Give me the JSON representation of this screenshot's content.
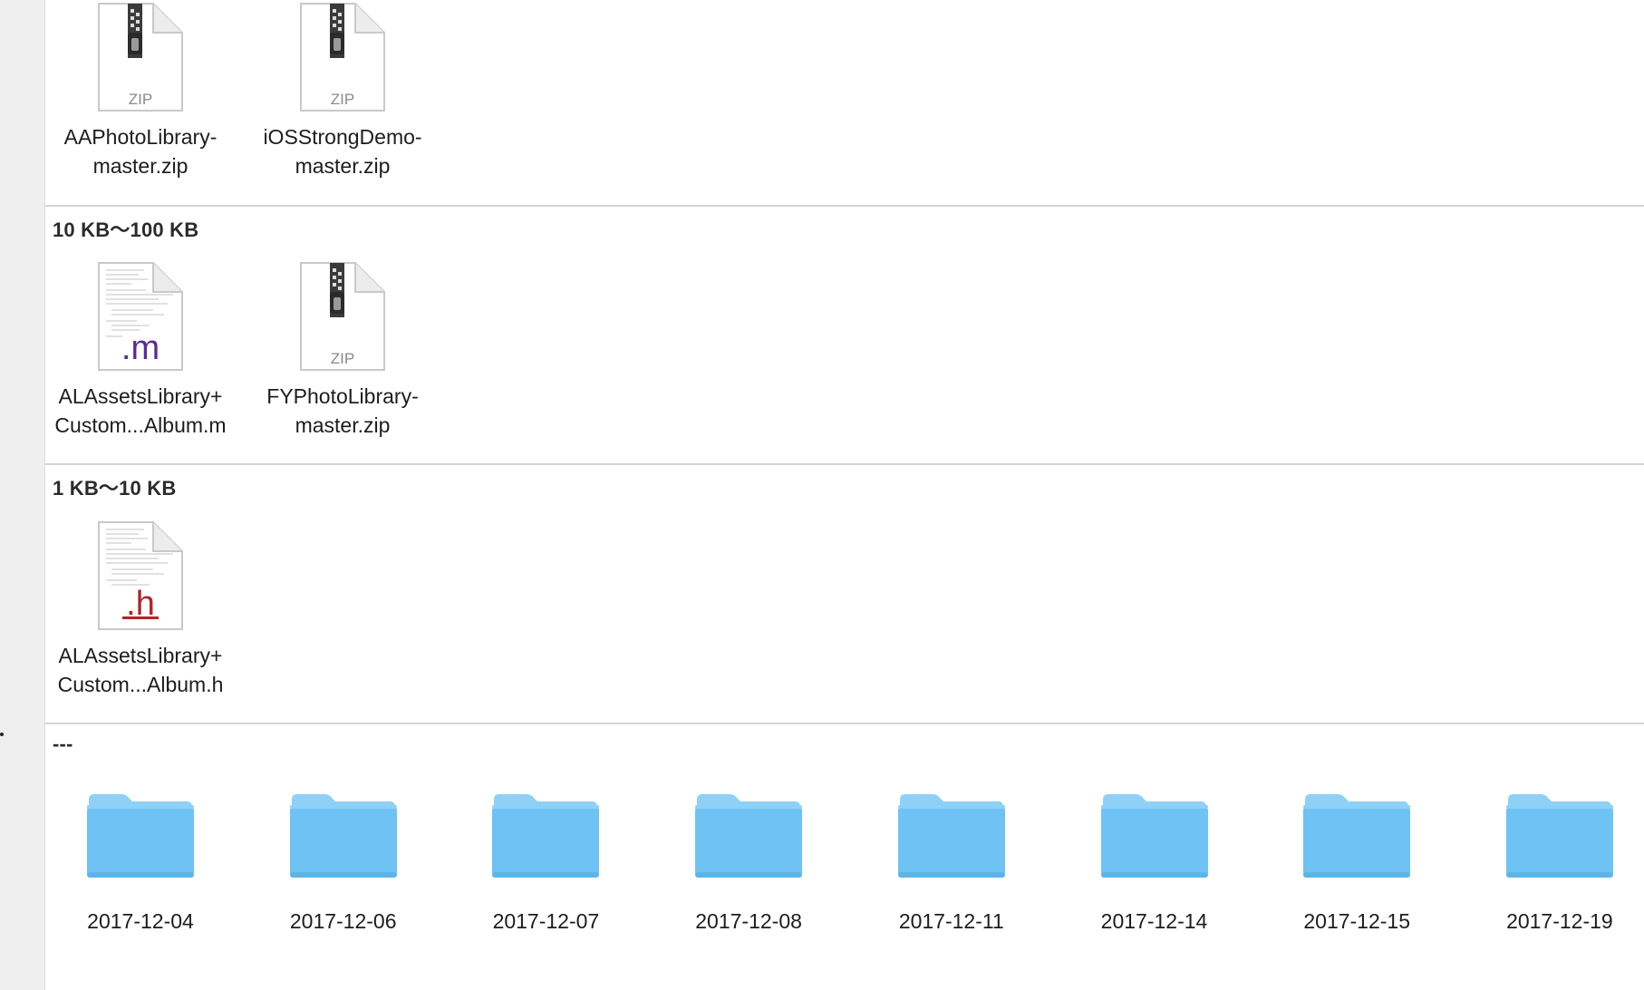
{
  "groups": [
    {
      "items": [
        {
          "name": "AAPhotoLibrary-\nmaster.zip",
          "kind": "zip",
          "badge": "ZIP"
        },
        {
          "name": "iOSStrongDemo-\nmaster.zip",
          "kind": "zip",
          "badge": "ZIP"
        }
      ]
    },
    {
      "header": "10 KB～100 KB",
      "items": [
        {
          "name": "ALAssetsLibrary+\nCustom...Album.m",
          "kind": "source",
          "badge": ".m",
          "badge_color": "#5b2a9a"
        },
        {
          "name": "FYPhotoLibrary-\nmaster.zip",
          "kind": "zip",
          "badge": "ZIP"
        }
      ]
    },
    {
      "header": "1 KB～10 KB",
      "items": [
        {
          "name": "ALAssetsLibrary+\nCustom...Album.h",
          "kind": "source",
          "badge": ".h",
          "badge_color": "#b1232a"
        }
      ]
    },
    {
      "header": "---",
      "items": [
        {
          "name": "2017-12-04",
          "kind": "folder"
        },
        {
          "name": "2017-12-06",
          "kind": "folder"
        },
        {
          "name": "2017-12-07",
          "kind": "folder"
        },
        {
          "name": "2017-12-08",
          "kind": "folder"
        },
        {
          "name": "2017-12-11",
          "kind": "folder"
        },
        {
          "name": "2017-12-14",
          "kind": "folder"
        },
        {
          "name": "2017-12-15",
          "kind": "folder"
        },
        {
          "name": "2017-12-19",
          "kind": "folder"
        }
      ]
    }
  ],
  "colors": {
    "folder_top": "#8fd0f7",
    "folder_body": "#6ec3f4",
    "folder_edge": "#5db4e8"
  }
}
